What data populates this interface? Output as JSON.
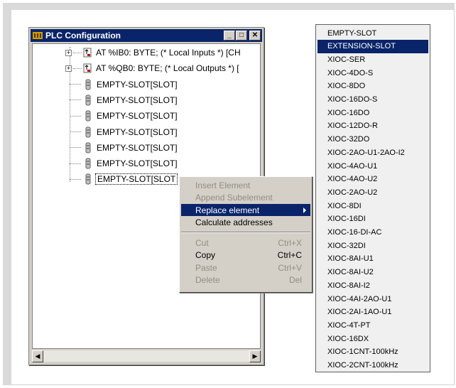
{
  "window": {
    "title": "PLC Configuration",
    "minimize": "_",
    "maximize": "□",
    "close": "✕"
  },
  "tree": {
    "rows": [
      {
        "label": "AT %IB0: BYTE; (* Local Inputs *) [CH",
        "icon": "input-module-icon",
        "expand": "+"
      },
      {
        "label": "AT %QB0: BYTE; (* Local Outputs *) [",
        "icon": "output-module-icon",
        "expand": "+"
      },
      {
        "label": "EMPTY-SLOT[SLOT]",
        "icon": "slot-icon"
      },
      {
        "label": "EMPTY-SLOT[SLOT]",
        "icon": "slot-icon"
      },
      {
        "label": "EMPTY-SLOT[SLOT]",
        "icon": "slot-icon"
      },
      {
        "label": "EMPTY-SLOT[SLOT]",
        "icon": "slot-icon"
      },
      {
        "label": "EMPTY-SLOT[SLOT]",
        "icon": "slot-icon"
      },
      {
        "label": "EMPTY-SLOT[SLOT]",
        "icon": "slot-icon"
      },
      {
        "label": "EMPTY-SLOT[SLOT",
        "icon": "slot-icon",
        "selected": true
      }
    ]
  },
  "context_menu": {
    "items": [
      {
        "label": "Insert Element",
        "shortcut": "",
        "disabled": true
      },
      {
        "label": "Append Subelement",
        "shortcut": "",
        "disabled": true
      },
      {
        "label": "Replace element",
        "shortcut": "",
        "submenu": true,
        "highlighted": true
      },
      {
        "label": "Calculate addresses",
        "shortcut": ""
      },
      {
        "separator": true
      },
      {
        "label": "Cut",
        "shortcut": "Ctrl+X",
        "disabled": true
      },
      {
        "label": "Copy",
        "shortcut": "Ctrl+C"
      },
      {
        "label": "Paste",
        "shortcut": "Ctrl+V",
        "disabled": true
      },
      {
        "label": "Delete",
        "shortcut": "Del",
        "disabled": true
      }
    ]
  },
  "submenu": {
    "selected": "EXTENSION-SLOT",
    "items": [
      "EMPTY-SLOT",
      "EXTENSION-SLOT",
      "XIOC-SER",
      "XIOC-4DO-S",
      "XIOC-8DO",
      "XIOC-16DO-S",
      "XIOC-16DO",
      "XIOC-12DO-R",
      "XIOC-32DO",
      "XIOC-2AO-U1-2AO-I2",
      "XIOC-4AO-U1",
      "XIOC-4AO-U2",
      "XIOC-2AO-U2",
      "XIOC-8DI",
      "XIOC-16DI",
      "XIOC-16-DI-AC",
      "XIOC-32DI",
      "XIOC-8AI-U1",
      "XIOC-8AI-U2",
      "XIOC-8AI-I2",
      "XIOC-4AI-2AO-U1",
      "XIOC-2AI-1AO-U1",
      "XIOC-4T-PT",
      "XIOC-16DX",
      "XIOC-1CNT-100kHz",
      "XIOC-2CNT-100kHz"
    ]
  },
  "colors": {
    "titlebar": "#0a246a",
    "highlight": "#0a246a",
    "face": "#d4d0c8"
  }
}
